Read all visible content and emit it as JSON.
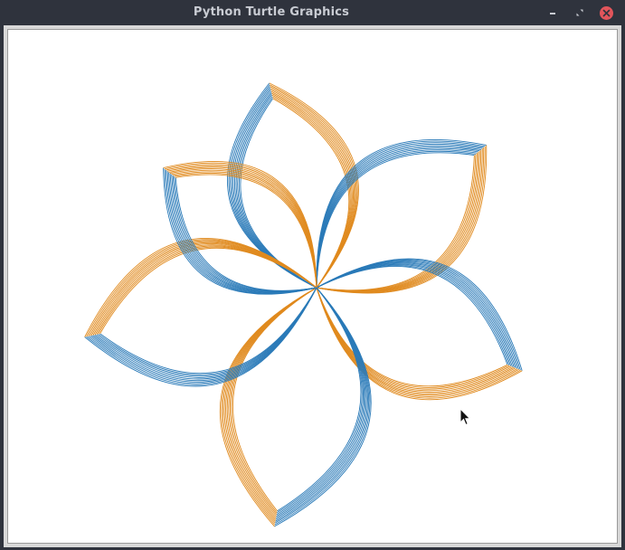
{
  "window": {
    "title": "Python Turtle Graphics",
    "controls": [
      "minimize-icon",
      "restore-icon",
      "close-icon"
    ]
  },
  "canvas": {
    "background": "#ffffff",
    "drawing": "six-petal flower of nested arcs",
    "colors": {
      "blue": "#2a7ab8",
      "orange": "#e08a1e"
    },
    "petal_count": 6,
    "arcs_per_side": 10
  },
  "theme": {
    "titlebar_bg": "#2f333d",
    "title_color": "#c9ccd3",
    "close_button": "#e2555b"
  }
}
